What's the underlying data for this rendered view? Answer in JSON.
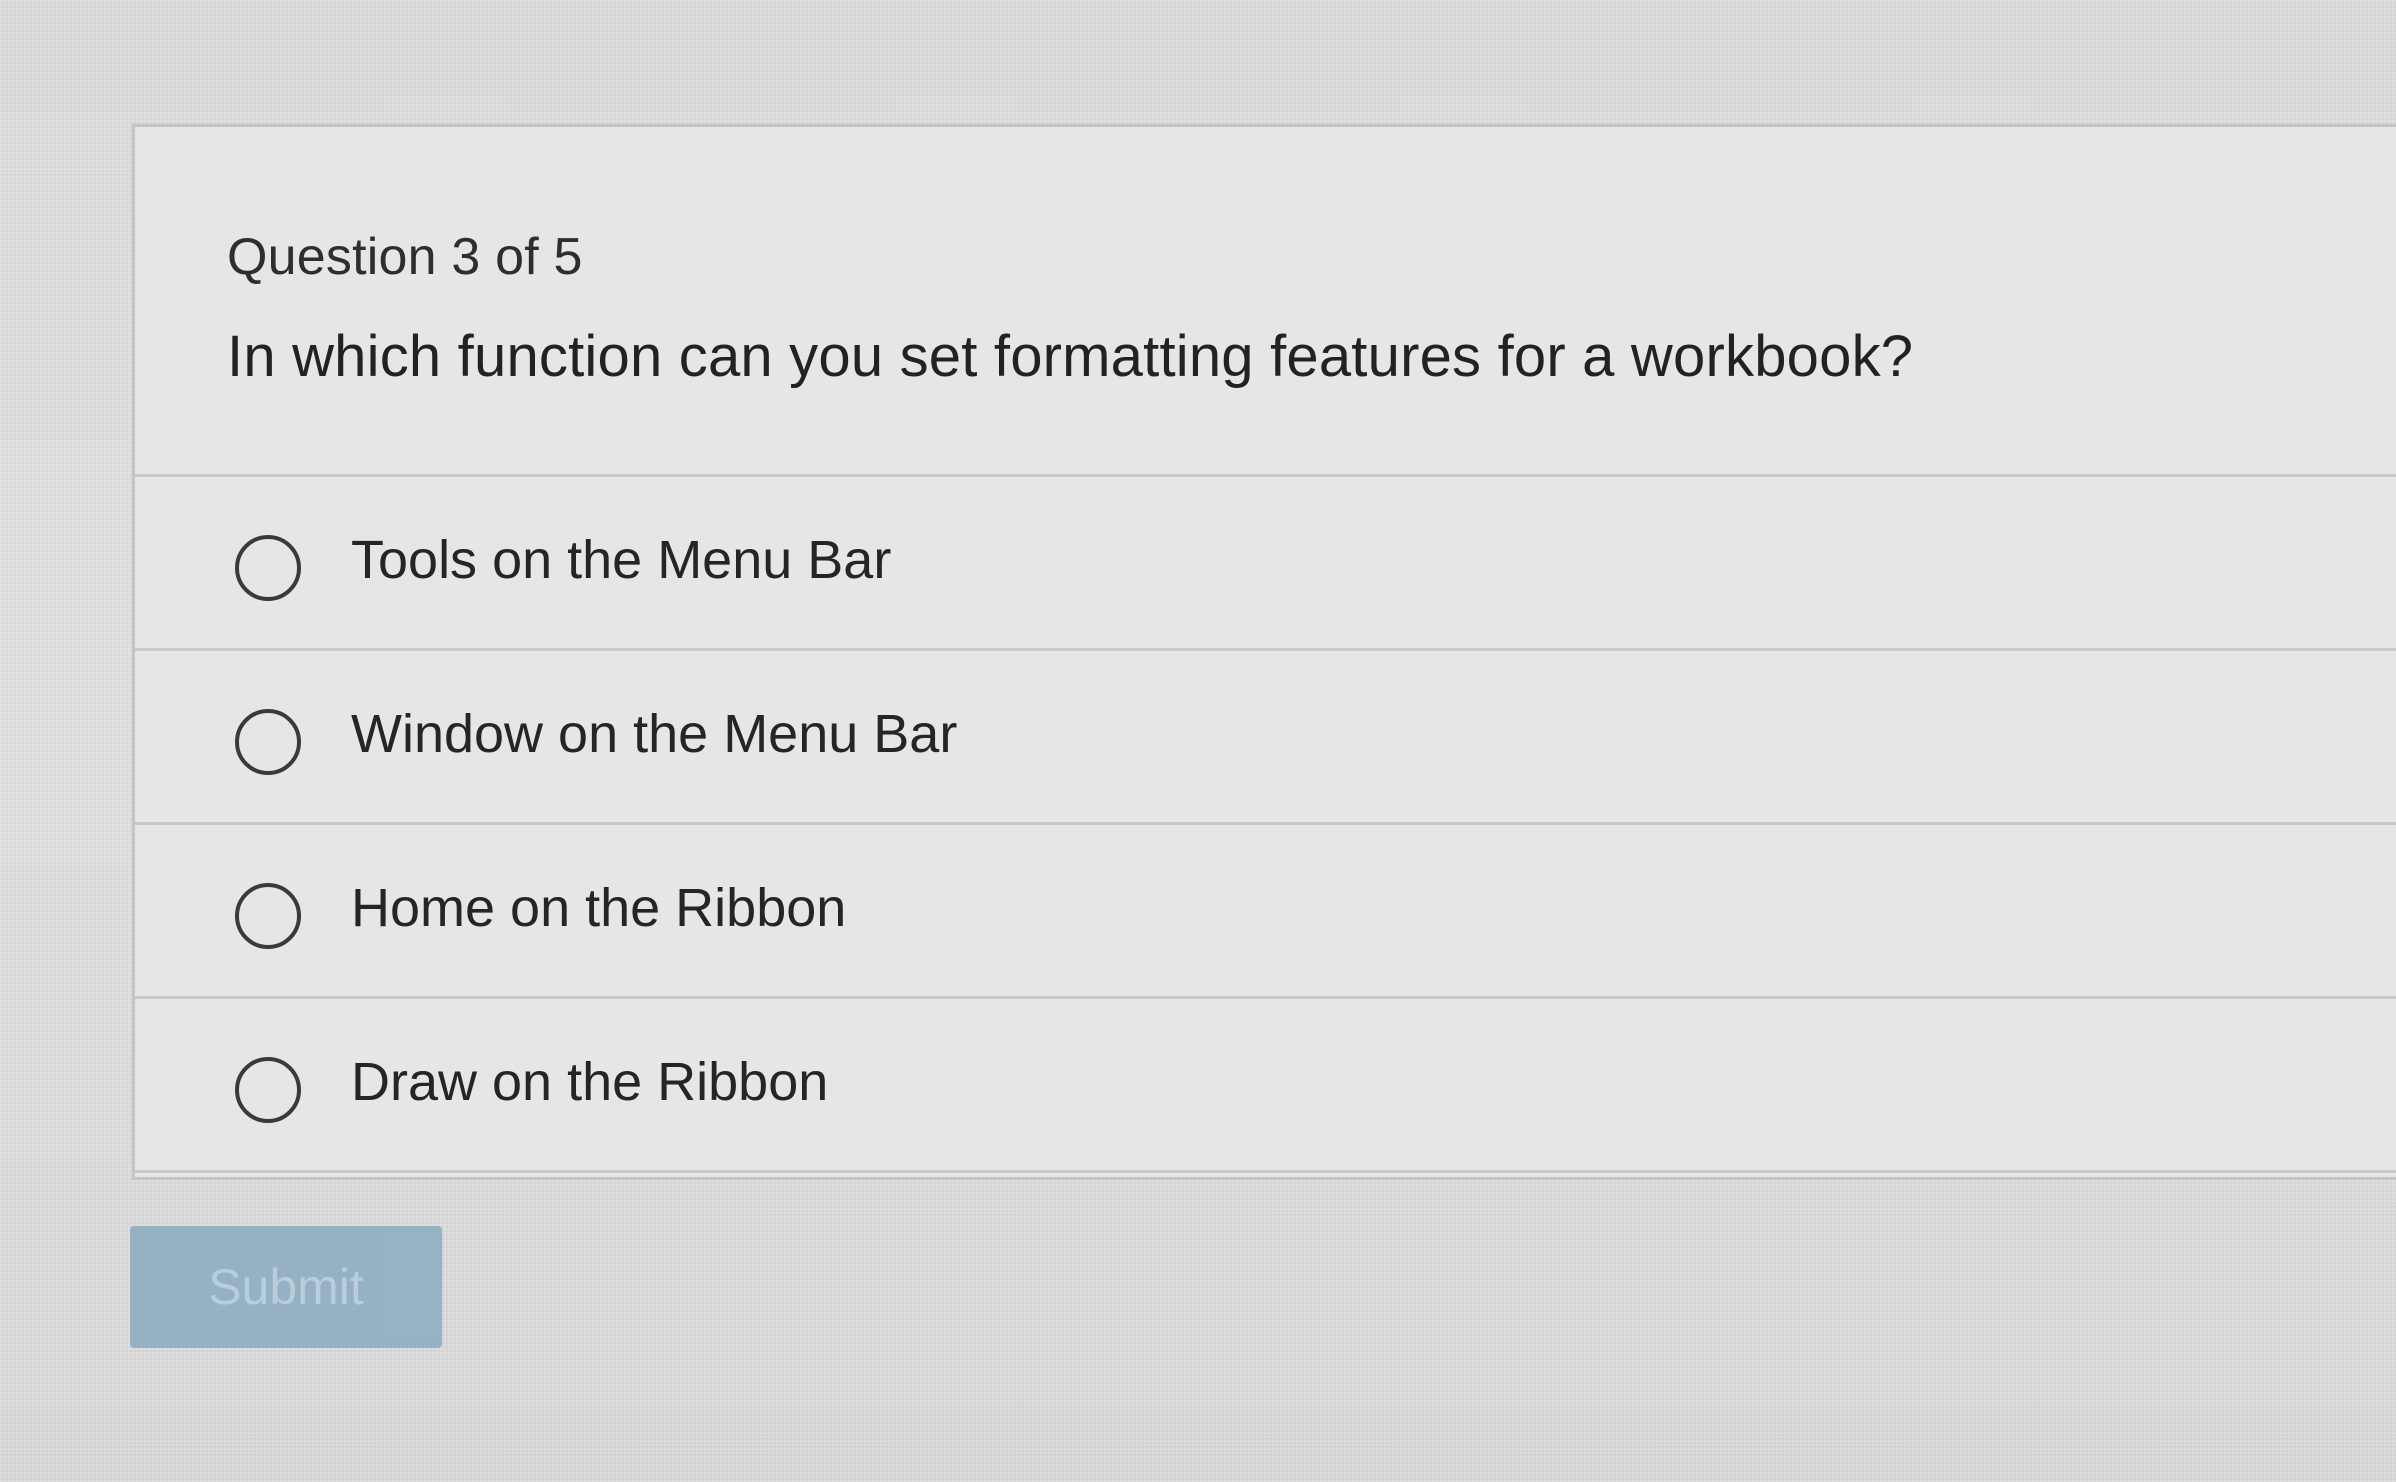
{
  "quiz": {
    "counter": "Question 3 of 5",
    "question": "In which function can you set formatting features for a workbook?",
    "options": [
      {
        "label": "Tools on the Menu Bar",
        "selected": false
      },
      {
        "label": "Window on the Menu Bar",
        "selected": false
      },
      {
        "label": "Home on the Ribbon",
        "selected": false
      },
      {
        "label": "Draw on the Ribbon",
        "selected": false
      }
    ],
    "submit_label": "Submit",
    "submit_enabled": false
  },
  "colors": {
    "background": "#e1e1e1",
    "card": "#e6e6e6",
    "border": "#c9c9c9",
    "submit_disabled": "#8eaec2",
    "text": "#252525"
  }
}
